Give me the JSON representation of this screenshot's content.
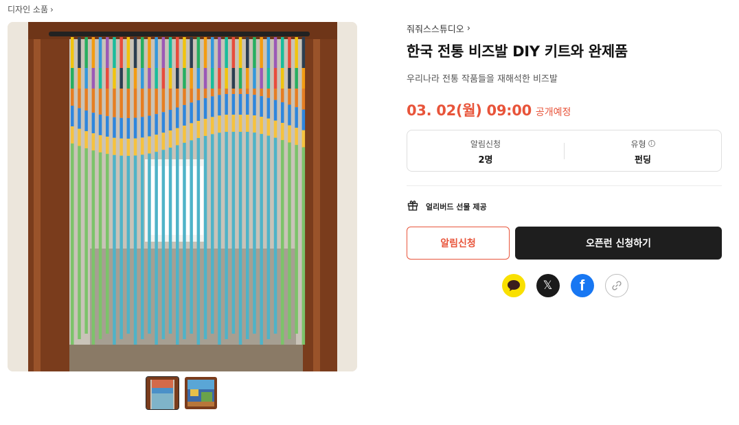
{
  "breadcrumb": {
    "category": "디자인 소품"
  },
  "product": {
    "studio": "줘줘스스튜디오",
    "title": "한국 전통 비즈발 DIY 키트와 완제품",
    "subtitle": "우리나라 전통 작품들을 재해석한 비즈발",
    "open_date": "03. 02(월) 09:00",
    "open_label": "공개예정"
  },
  "stats": [
    {
      "label": "알림신청",
      "value": "2명"
    },
    {
      "label": "유형",
      "value": "펀딩",
      "icon": "info-icon"
    }
  ],
  "benefit": {
    "icon": "gift-icon",
    "text": "얼리버드 선물 제공"
  },
  "buttons": {
    "notify": "알림신청",
    "apply": "오픈런 신청하기"
  },
  "share": [
    "kakao-icon",
    "x-icon",
    "facebook-icon",
    "link-icon"
  ],
  "colors": {
    "accent": "#e8543a",
    "dark_button": "#1e1e1e",
    "kakao": "#f9e000",
    "facebook": "#1877f2"
  }
}
